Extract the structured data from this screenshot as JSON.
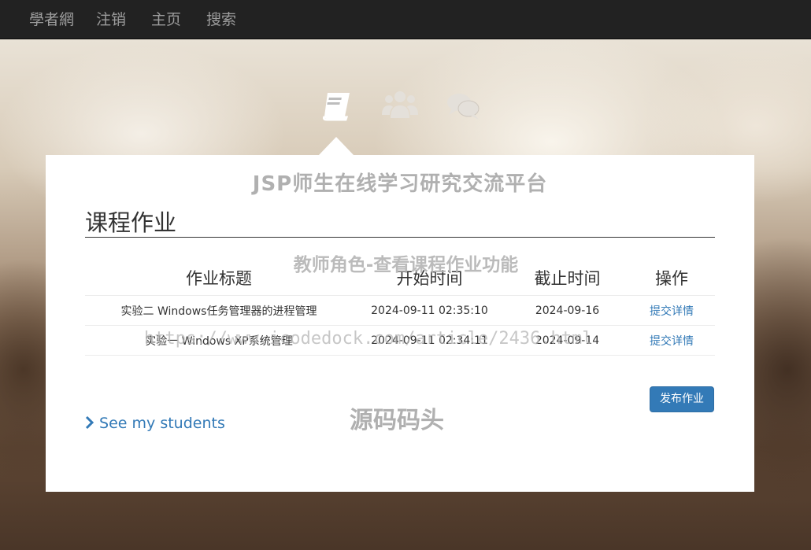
{
  "navbar": {
    "brand": "學者網",
    "items": [
      {
        "label": "注销"
      },
      {
        "label": "主页"
      },
      {
        "label": "搜索"
      }
    ]
  },
  "tabs": [
    {
      "icon": "book-icon",
      "active": true
    },
    {
      "icon": "users-icon",
      "active": false
    },
    {
      "icon": "comments-icon",
      "active": false
    }
  ],
  "watermarks": {
    "site_title": "JSP师生在线学习研究交流平台",
    "role": "教师角色-查看课程作业功能",
    "url": "https://www.icodedock.com/article/2436.html",
    "source": "源码码头"
  },
  "main": {
    "section_title": "课程作业",
    "table": {
      "headers": [
        "作业标题",
        "开始时间",
        "截止时间",
        "操作"
      ],
      "rows": [
        {
          "title": "实验二 Windows任务管理器的进程管理",
          "start": "2024-09-11 02:35:10",
          "end": "2024-09-16",
          "action": "提交详情"
        },
        {
          "title": "实验一 Windows XP系统管理",
          "start": "2024-09-11 02:34:11",
          "end": "2024-09-14",
          "action": "提交详情"
        }
      ]
    },
    "publish_label": "发布作业",
    "students_link": "See my students"
  },
  "colors": {
    "navbar_bg": "#222222",
    "nav_text": "#9d9d9d",
    "link": "#337ab7",
    "primary_button": "#337ab7"
  }
}
